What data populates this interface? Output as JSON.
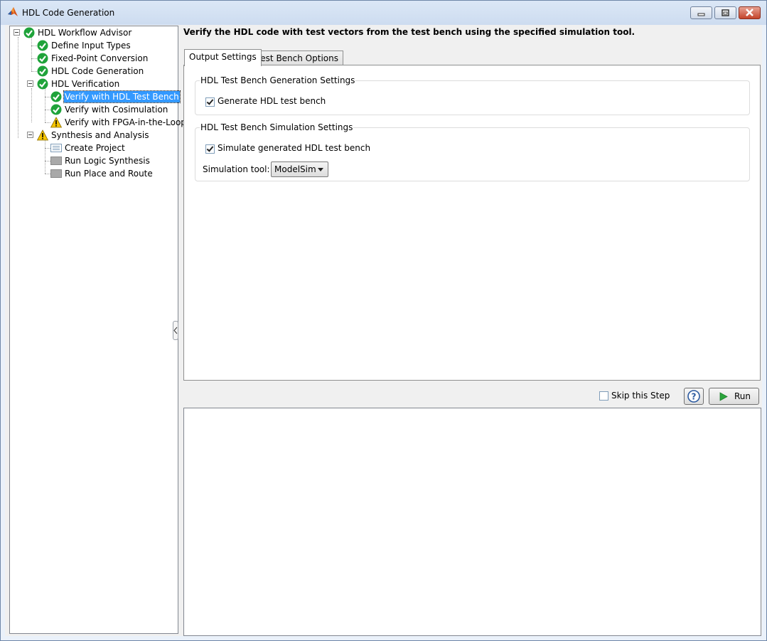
{
  "window": {
    "title": "HDL Code Generation",
    "buttons": [
      "minimize-icon",
      "maximize-icon",
      "close-icon"
    ]
  },
  "tree": {
    "root": "HDL Workflow Advisor",
    "items": [
      {
        "label": "Define Input Types",
        "status": "passed"
      },
      {
        "label": "Fixed-Point Conversion",
        "status": "passed"
      },
      {
        "label": "HDL Code Generation",
        "status": "passed"
      },
      {
        "label": "HDL Verification",
        "status": "passed"
      },
      {
        "label": "Verify with HDL Test Bench",
        "status": "passed",
        "selected": true
      },
      {
        "label": "Verify with Cosimulation",
        "status": "passed"
      },
      {
        "label": "Verify with FPGA-in-the-Loop",
        "status": "warning"
      },
      {
        "label": "Synthesis and Analysis",
        "status": "warning"
      },
      {
        "label": "Create Project",
        "status": "task"
      },
      {
        "label": "Run Logic Synthesis",
        "status": "not-run"
      },
      {
        "label": "Run Place and Route",
        "status": "not-run"
      }
    ]
  },
  "main": {
    "header": "Verify the HDL code with test vectors from the test bench using the specified simulation tool.",
    "tabs": [
      {
        "label": "Output Settings",
        "active": true
      },
      {
        "label": "Test Bench Options",
        "active": false
      }
    ],
    "groups": {
      "generation": {
        "title": "HDL Test Bench Generation Settings",
        "checkbox_label": "Generate HDL test bench",
        "checked": true
      },
      "simulation": {
        "title": "HDL Test Bench Simulation Settings",
        "checkbox_label": "Simulate generated HDL test bench",
        "checked": true,
        "tool_label": "Simulation tool:",
        "tool_value": "ModelSim"
      }
    }
  },
  "actions": {
    "skip_label": "Skip this Step",
    "skip_checked": false,
    "help_icon": "?",
    "run_label": "Run"
  },
  "colors": {
    "passed": "#1fa33a",
    "warning": "#f5c400",
    "selection": "#3399ff"
  }
}
